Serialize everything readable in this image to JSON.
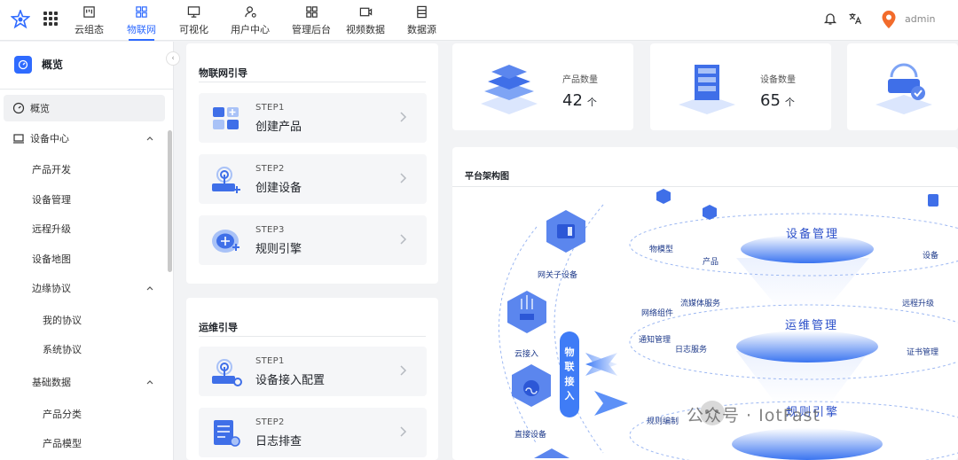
{
  "topnav": {
    "items": [
      {
        "label": "云组态",
        "icon": "dashboard-icon"
      },
      {
        "label": "物联网",
        "icon": "iot-icon",
        "active": true
      },
      {
        "label": "可视化",
        "icon": "monitor-icon"
      },
      {
        "label": "用户中心",
        "icon": "user-settings-icon"
      },
      {
        "label": "管理后台",
        "icon": "admin-grid-icon"
      },
      {
        "label": "视频数据",
        "icon": "video-icon"
      },
      {
        "label": "数据源",
        "icon": "datasource-icon"
      }
    ],
    "username": "admin",
    "accent": "#2f6bff"
  },
  "sidebar": {
    "title": "概览",
    "items": [
      {
        "label": "概览",
        "selected": true
      },
      {
        "label": "设备中心"
      },
      {
        "label": "产品开发"
      },
      {
        "label": "设备管理"
      },
      {
        "label": "远程升级"
      },
      {
        "label": "设备地图"
      },
      {
        "label": "边缘协议"
      },
      {
        "label": "我的协议"
      },
      {
        "label": "系统协议"
      },
      {
        "label": "基础数据"
      },
      {
        "label": "产品分类"
      },
      {
        "label": "产品模型"
      }
    ]
  },
  "iot_guide": {
    "title": "物联网引导",
    "steps": [
      {
        "step": "STEP1",
        "name": "创建产品"
      },
      {
        "step": "STEP2",
        "name": "创建设备"
      },
      {
        "step": "STEP3",
        "name": "规则引擎"
      }
    ]
  },
  "ops_guide": {
    "title": "运维引导",
    "steps": [
      {
        "step": "STEP1",
        "name": "设备接入配置"
      },
      {
        "step": "STEP2",
        "name": "日志排查"
      }
    ]
  },
  "stats": [
    {
      "label": "产品数量",
      "value": "42",
      "unit": "个"
    },
    {
      "label": "设备数量",
      "value": "65",
      "unit": "个"
    }
  ],
  "architecture": {
    "title": "平台架构图",
    "left_nodes": [
      "网关子设备",
      "云接入",
      "直接设备"
    ],
    "access_label": [
      "物",
      "联",
      "接",
      "入"
    ],
    "ring1": {
      "title": "设备管理",
      "tags": [
        "物模型",
        "产品",
        "设备"
      ]
    },
    "ring2": {
      "title": "运维管理",
      "tags": [
        "网络组件",
        "流媒体服务",
        "通知管理",
        "日志服务",
        "远程升级",
        "证书管理"
      ]
    },
    "ring3": {
      "title": "规则引擎",
      "tags": [
        "规则编制"
      ]
    }
  },
  "watermark": "公众号 · IotFast"
}
